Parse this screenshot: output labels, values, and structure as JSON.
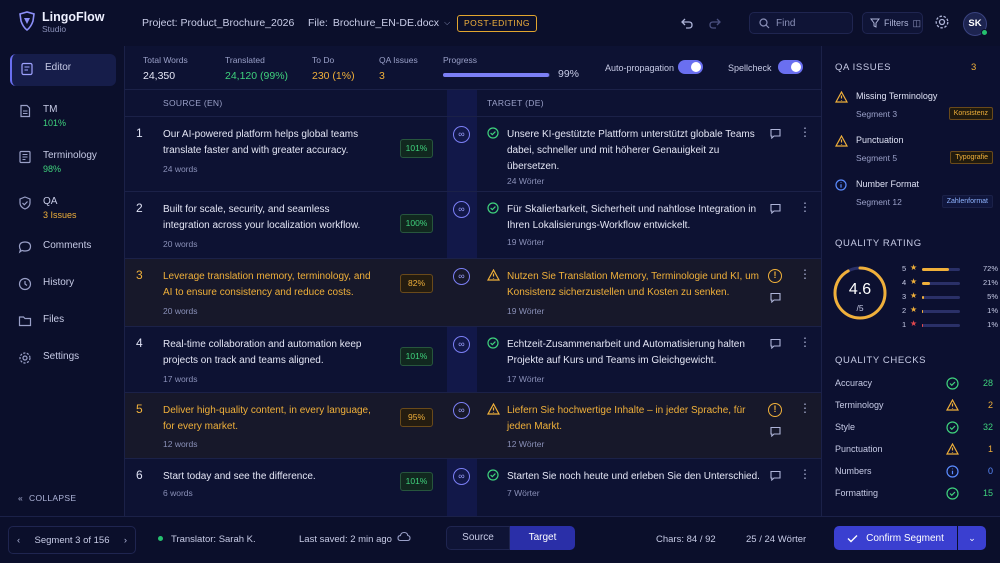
{
  "app": {
    "name": "LingoFlow",
    "subtitle": "Studio"
  },
  "header": {
    "project_label": "Project:",
    "project": "Product_Brochure_2026",
    "file_label": "File:",
    "file": "Brochure_EN-DE.docx",
    "status_badge": "POST-EDITING",
    "find_placeholder": "Find",
    "filters_label": "Filters",
    "avatar_initials": "SK"
  },
  "sidebar": {
    "items": [
      {
        "label": "Editor",
        "sub": "",
        "icon": "editor-icon"
      },
      {
        "label": "TM",
        "sub": "101%",
        "icon": "document-icon"
      },
      {
        "label": "Terminology",
        "sub": "98%",
        "icon": "glossary-icon"
      },
      {
        "label": "QA",
        "sub": "3 Issues",
        "icon": "shield-check-icon"
      },
      {
        "label": "Comments",
        "sub": "",
        "icon": "comment-icon"
      },
      {
        "label": "History",
        "sub": "",
        "icon": "clock-icon"
      },
      {
        "label": "Files",
        "sub": "",
        "icon": "folder-icon"
      },
      {
        "label": "Settings",
        "sub": "",
        "icon": "gear-icon"
      }
    ],
    "collapse_label": "COLLAPSE"
  },
  "stats": {
    "total_words_label": "Total Words",
    "total_words": "24,350",
    "translated_label": "Translated",
    "translated": "24,120 (99%)",
    "todo_label": "To Do",
    "todo": "230 (1%)",
    "qa_issues_label": "QA Issues",
    "qa_issues": "3",
    "progress_label": "Progress",
    "progress": "99%",
    "progress_value": 0.99,
    "auto_propagation_label": "Auto-propagation",
    "auto_propagation_on": true,
    "spellcheck_label": "Spellcheck",
    "spellcheck_on": true
  },
  "columns": {
    "source": "SOURCE (EN)",
    "target": "TARGET (DE)"
  },
  "segments": [
    {
      "num": "1",
      "source": "Our AI-powered platform helps global teams translate faster and with greater accuracy.",
      "source_words": "24 words",
      "match": "101%",
      "target": "Unsere KI-gestützte Plattform unterstützt globale Teams dabei, schneller und mit höherer Genauigkeit zu übersetzen.",
      "target_words": "24 Wörter",
      "status": "ok"
    },
    {
      "num": "2",
      "source": "Built for scale, security, and seamless integration across your localization workflow.",
      "source_words": "20 words",
      "match": "100%",
      "target": "Für Skalierbarkeit, Sicherheit und nahtlose Integration in Ihren Lokalisierungs-Workflow entwickelt.",
      "target_words": "19 Wörter",
      "status": "ok"
    },
    {
      "num": "3",
      "source": "Leverage translation memory, terminology, and AI to ensure consistency and reduce costs.",
      "source_words": "20 words",
      "match": "82%",
      "target": "Nutzen Sie Translation Memory, Terminologie und KI, um Konsistenz sicherzustellen und Kosten zu senken.",
      "target_words": "19 Wörter",
      "status": "warning"
    },
    {
      "num": "4",
      "source": "Real-time collaboration and automation keep projects on track and teams aligned.",
      "source_words": "17 words",
      "match": "101%",
      "target": "Echtzeit-Zusammenarbeit und Automatisierung halten Projekte auf Kurs und Teams im Gleichgewicht.",
      "target_words": "17 Wörter",
      "status": "ok"
    },
    {
      "num": "5",
      "source": "Deliver high-quality content, in every language, for every market.",
      "source_words": "12 words",
      "match": "95%",
      "target": "Liefern Sie hochwertige Inhalte – in jeder Sprache, für jeden Markt.",
      "target_words": "12 Wörter",
      "status": "warning"
    },
    {
      "num": "6",
      "source": "Start today and see the difference.",
      "source_words": "6 words",
      "match": "101%",
      "target": "Starten Sie noch heute und erleben Sie den Unterschied.",
      "target_words": "7 Wörter",
      "status": "ok"
    }
  ],
  "qa_panel": {
    "title": "QA ISSUES",
    "count": "3",
    "issues": [
      {
        "title": "Missing Terminology",
        "segment": "Segment 3",
        "tag": "Konsistenz",
        "kind": "warning"
      },
      {
        "title": "Punctuation",
        "segment": "Segment 5",
        "tag": "Typografie",
        "kind": "warning"
      },
      {
        "title": "Number Format",
        "segment": "Segment 12",
        "tag": "Zahlenformat",
        "kind": "info"
      }
    ]
  },
  "quality_rating": {
    "title": "QUALITY RATING",
    "score": "4.6",
    "out_of": "/5",
    "score_value": 4.6,
    "distribution": [
      {
        "stars": "5",
        "pct": "72%",
        "value": 72,
        "color": "#f0b03a"
      },
      {
        "stars": "4",
        "pct": "21%",
        "value": 21,
        "color": "#f0b03a"
      },
      {
        "stars": "3",
        "pct": "5%",
        "value": 5,
        "color": "#f0b03a"
      },
      {
        "stars": "2",
        "pct": "1%",
        "value": 1,
        "color": "#f0b03a"
      },
      {
        "stars": "1",
        "pct": "1%",
        "value": 1,
        "color": "#e5484d"
      }
    ]
  },
  "quality_checks": {
    "title": "QUALITY CHECKS",
    "items": [
      {
        "label": "Accuracy",
        "count": "28",
        "kind": "ok"
      },
      {
        "label": "Terminology",
        "count": "2",
        "kind": "warning"
      },
      {
        "label": "Style",
        "count": "32",
        "kind": "ok"
      },
      {
        "label": "Punctuation",
        "count": "1",
        "kind": "warning"
      },
      {
        "label": "Numbers",
        "count": "0",
        "kind": "info"
      },
      {
        "label": "Formatting",
        "count": "15",
        "kind": "ok"
      }
    ]
  },
  "footer": {
    "segment": "Segment 3 of 156",
    "translator": "Translator: Sarah K.",
    "saved": "Last saved: 2 min ago",
    "source_btn": "Source",
    "target_btn": "Target",
    "chars": "Chars: 84 / 92",
    "words": "25 / 24 Wörter",
    "confirm": "Confirm Segment"
  },
  "colors": {
    "accent": "#6a6ff0",
    "success": "#3fd27d",
    "warning": "#f0b03a",
    "info": "#5b8cff",
    "danger": "#e5484d"
  }
}
